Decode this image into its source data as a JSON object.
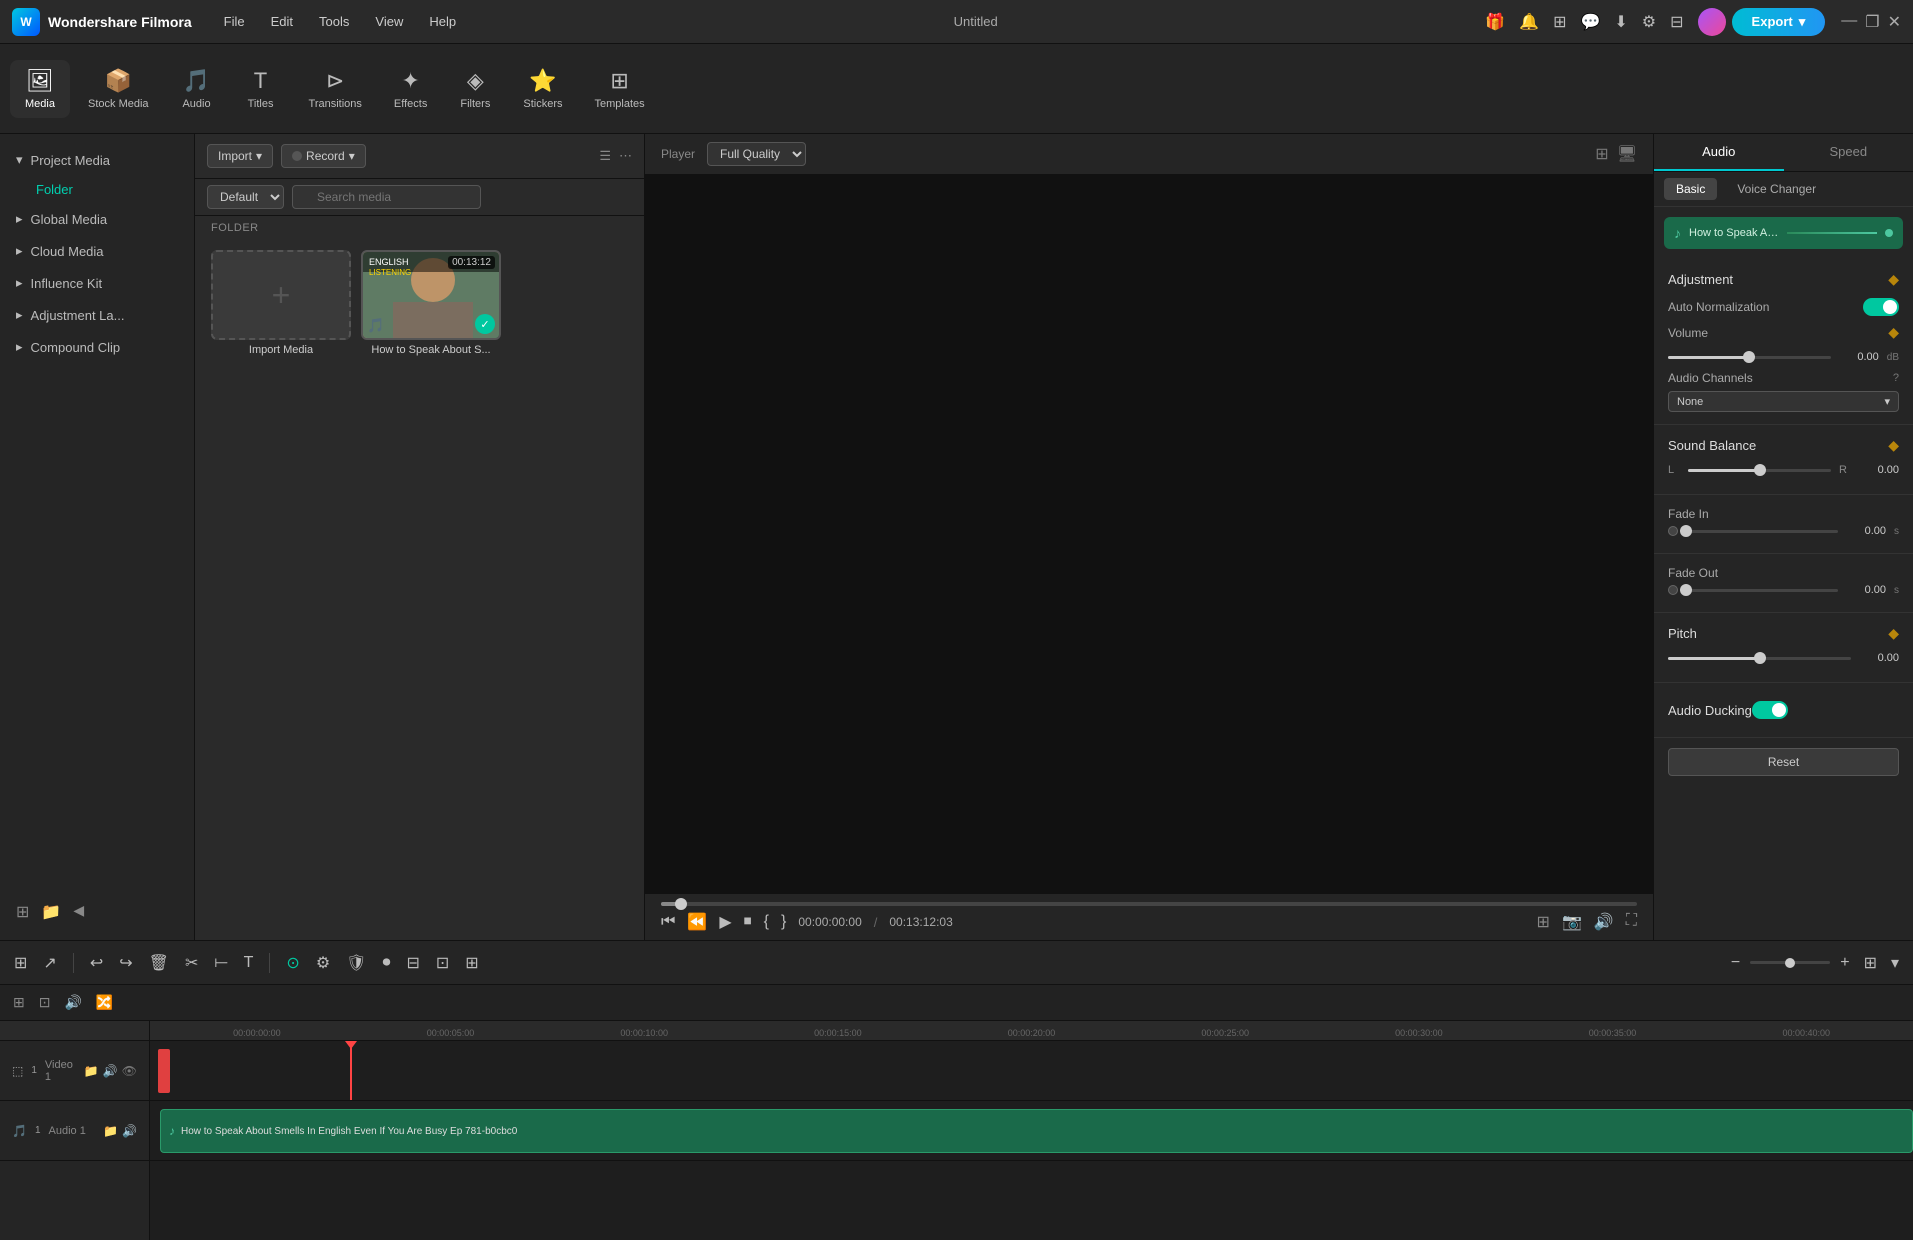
{
  "app": {
    "name": "Wondershare Filmora",
    "title": "Untitled"
  },
  "menubar": {
    "items": [
      "File",
      "Edit",
      "Tools",
      "View",
      "Help"
    ],
    "export_label": "Export",
    "window_controls": [
      "—",
      "❐",
      "✕"
    ]
  },
  "toolbar": {
    "items": [
      {
        "id": "media",
        "icon": "🖼",
        "label": "Media",
        "active": true
      },
      {
        "id": "stock",
        "icon": "📦",
        "label": "Stock Media"
      },
      {
        "id": "audio",
        "icon": "🎵",
        "label": "Audio"
      },
      {
        "id": "titles",
        "icon": "T",
        "label": "Titles"
      },
      {
        "id": "transitions",
        "icon": "▷",
        "label": "Transitions"
      },
      {
        "id": "effects",
        "icon": "✦",
        "label": "Effects"
      },
      {
        "id": "filters",
        "icon": "◈",
        "label": "Filters"
      },
      {
        "id": "stickers",
        "icon": "⭐",
        "label": "Stickers"
      },
      {
        "id": "templates",
        "icon": "⊞",
        "label": "Templates"
      }
    ]
  },
  "sidebar": {
    "items": [
      {
        "id": "project-media",
        "label": "Project Media",
        "expanded": true
      },
      {
        "sub": "Folder"
      },
      {
        "id": "global-media",
        "label": "Global Media"
      },
      {
        "id": "cloud-media",
        "label": "Cloud Media"
      },
      {
        "id": "influence-kit",
        "label": "Influence Kit"
      },
      {
        "id": "adjustment-la",
        "label": "Adjustment La..."
      },
      {
        "id": "compound-clip",
        "label": "Compound Clip"
      }
    ]
  },
  "media_panel": {
    "import_label": "Import",
    "record_label": "Record",
    "view_default": "Default",
    "search_placeholder": "Search media",
    "folder_label": "FOLDER",
    "items": [
      {
        "id": "import",
        "type": "import",
        "name": "Import Media"
      },
      {
        "id": "clip1",
        "type": "video",
        "name": "How to Speak About S...",
        "duration": "00:13:12",
        "has_check": true
      }
    ]
  },
  "preview": {
    "player_label": "Player",
    "quality": "Full Quality",
    "current_time": "00:00:00:00",
    "total_time": "00:13:12:03",
    "controls": {
      "rewind": "⏮",
      "step_back": "⏪",
      "play": "▶",
      "stop": "⏹",
      "mark_in": "{",
      "mark_out": "}",
      "fullscreen": "⛶"
    }
  },
  "right_panel": {
    "tabs": [
      "Audio",
      "Speed"
    ],
    "active_tab": "Audio",
    "sub_tabs": [
      "Basic",
      "Voice Changer"
    ],
    "active_sub_tab": "Basic",
    "clip_name": "How to Speak Abo...",
    "sections": {
      "adjustment": {
        "title": "Adjustment",
        "auto_normalization": {
          "label": "Auto Normalization",
          "enabled": true
        },
        "volume": {
          "label": "Volume",
          "value": "0.00",
          "unit": "dB",
          "position_pct": 50
        },
        "audio_channels": {
          "label": "Audio Channels",
          "value": "None",
          "has_help": true
        },
        "sound_balance": {
          "title": "Sound Balance",
          "left_label": "L",
          "right_label": "R",
          "value": "0.00",
          "position_pct": 50
        },
        "fade_in": {
          "label": "Fade In",
          "value": "0.00",
          "unit": "s",
          "position_pct": 0
        },
        "fade_out": {
          "label": "Fade Out",
          "value": "0.00",
          "unit": "s",
          "position_pct": 0
        },
        "pitch": {
          "title": "Pitch",
          "value": "0.00",
          "position_pct": 50
        },
        "audio_ducking": {
          "title": "Audio Ducking",
          "enabled": true
        }
      }
    },
    "reset_label": "Reset"
  },
  "timeline": {
    "toolbar_buttons": [
      "⊞",
      "↗",
      "|",
      "↩",
      "↪",
      "🗑",
      "✂",
      "⟝",
      "T",
      "⬚",
      "≫"
    ],
    "secondary_buttons": [
      "⊞",
      "⊡",
      "⊟",
      "🔀"
    ],
    "ruler_marks": [
      "00:00:00:00",
      "00:00:05:00",
      "00:00:10:00",
      "00:00:15:00",
      "00:00:20:00",
      "00:00:25:00",
      "00:00:30:00",
      "00:00:35:00",
      "00:00:40:00"
    ],
    "tracks": [
      {
        "id": "video1",
        "type": "video",
        "number": "1",
        "label": "Video 1",
        "icons": [
          "⬚",
          "📁",
          "🔊",
          "👁"
        ]
      },
      {
        "id": "audio1",
        "type": "audio",
        "number": "1",
        "label": "Audio 1",
        "icons": [
          "🎵",
          "📁",
          "🔊"
        ]
      }
    ],
    "audio_clip": {
      "name": "How to Speak About Smells In English Even If You Are Busy Ep 781-b0cbc0"
    }
  }
}
